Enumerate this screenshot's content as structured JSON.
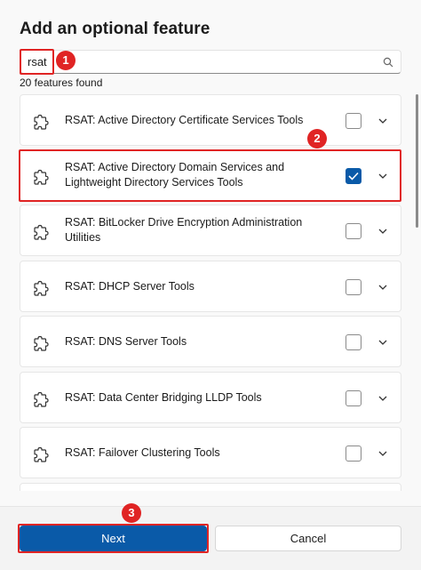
{
  "dialog": {
    "title": "Add an optional feature",
    "search": {
      "value": "rsat",
      "placeholder": ""
    },
    "count_label": "20 features found",
    "features": [
      {
        "label": "RSAT: Active Directory Certificate Services Tools",
        "checked": false
      },
      {
        "label": "RSAT: Active Directory Domain Services and Lightweight Directory Services Tools",
        "checked": true
      },
      {
        "label": "RSAT: BitLocker Drive Encryption Administration Utilities",
        "checked": false
      },
      {
        "label": "RSAT: DHCP Server Tools",
        "checked": false
      },
      {
        "label": "RSAT: DNS Server Tools",
        "checked": false
      },
      {
        "label": "RSAT: Data Center Bridging LLDP Tools",
        "checked": false
      },
      {
        "label": "RSAT: Failover Clustering Tools",
        "checked": false
      }
    ],
    "buttons": {
      "next": "Next",
      "cancel": "Cancel"
    }
  },
  "annotations": {
    "step1": "1",
    "step2": "2",
    "step3": "3"
  },
  "colors": {
    "accent": "#0a5aa8",
    "annotation": "#e02424"
  }
}
